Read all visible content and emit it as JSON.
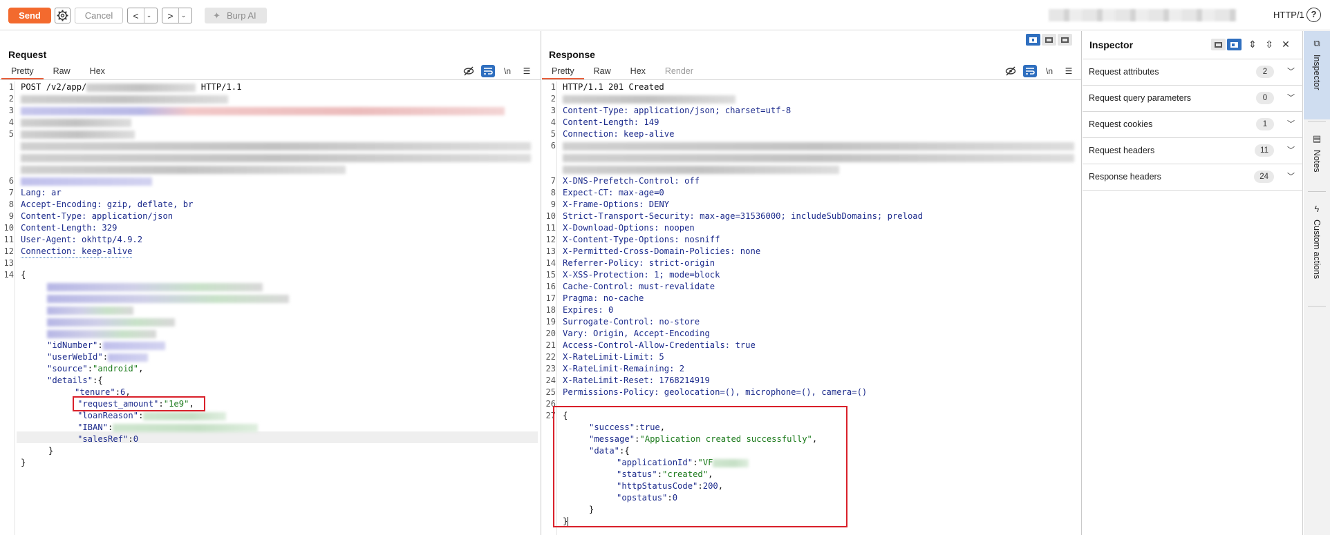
{
  "toolbar": {
    "send": "Send",
    "cancel": "Cancel",
    "back_glyph": "<",
    "forward_glyph": ">",
    "dropdown_glyph": "⌄",
    "burp_ai": "Burp AI",
    "protocol": "HTTP/1",
    "help": "?",
    "icons": [
      "gear-icon",
      "sparkle-icon",
      "help-icon"
    ]
  },
  "request": {
    "title": "Request",
    "tabs": [
      "Pretty",
      "Raw",
      "Hex"
    ],
    "active_tab": "Pretty",
    "lines": {
      "l1_method": "POST /v2/app/",
      "l1_proto": " HTTP/1.1",
      "l7": "Lang: ar",
      "l8": "Accept-Encoding: gzip, deflate, br",
      "l9": "Content-Type: application/json",
      "l10": "Content-Length: 329",
      "l11": "User-Agent: okhttp/4.9.2",
      "l12": "Connection: keep-alive",
      "l14": "{",
      "idNumber_key": "\"idNumber\"",
      "userWebId_key": "\"userWebId\"",
      "source_key": "\"source\"",
      "source_val": "\"android\"",
      "details_key": "\"details\"",
      "tenure_key": "\"tenure\"",
      "tenure_val": "6",
      "request_amount_key": "\"request_amount\"",
      "request_amount_val": "\"1e9\"",
      "loanReason_key": "\"loanReason\"",
      "iban_key": "\"IBAN\"",
      "salesRef_key": "\"salesRef\"",
      "salesRef_val": "0",
      "close_inner": "}",
      "close_outer": "}"
    }
  },
  "response": {
    "title": "Response",
    "tabs": [
      "Pretty",
      "Raw",
      "Hex",
      "Render"
    ],
    "active_tab": "Pretty",
    "lines": {
      "l1": "HTTP/1.1 201 Created",
      "l3": "Content-Type: application/json; charset=utf-8",
      "l4": "Content-Length: 149",
      "l5": "Connection: keep-alive",
      "l7": "X-DNS-Prefetch-Control: off",
      "l8": "Expect-CT: max-age=0",
      "l9": "X-Frame-Options: DENY",
      "l10": "Strict-Transport-Security: max-age=31536000; includeSubDomains; preload",
      "l11": "X-Download-Options: noopen",
      "l12": "X-Content-Type-Options: nosniff",
      "l13": "X-Permitted-Cross-Domain-Policies: none",
      "l14": "Referrer-Policy: strict-origin",
      "l15": "X-XSS-Protection: 1; mode=block",
      "l16": "Cache-Control: must-revalidate",
      "l17": "Pragma: no-cache",
      "l18": "Expires: 0",
      "l19": "Surrogate-Control: no-store",
      "l20": "Vary: Origin, Accept-Encoding",
      "l21": "Access-Control-Allow-Credentials: true",
      "l22": "X-RateLimit-Limit: 5",
      "l23": "X-RateLimit-Remaining: 2",
      "l24": "X-RateLimit-Reset: 1768214919",
      "l25": "Permissions-Policy: geolocation=(), microphone=(), camera=()",
      "l27": "{",
      "success_key": "\"success\"",
      "success_val": "true",
      "message_key": "\"message\"",
      "message_val": "\"Application created successfully\"",
      "data_key": "\"data\"",
      "applicationId_key": "\"applicationId\"",
      "applicationId_val": "\"VF",
      "status_key": "\"status\"",
      "status_val": "\"created\"",
      "httpStatusCode_key": "\"httpStatusCode\"",
      "httpStatusCode_val": "200",
      "opstatus_key": "\"opstatus\"",
      "opstatus_val": "0",
      "close_inner": "}",
      "close_outer": "}"
    }
  },
  "inspector": {
    "title": "Inspector",
    "rows": [
      {
        "label": "Request attributes",
        "count": "2"
      },
      {
        "label": "Request query parameters",
        "count": "0"
      },
      {
        "label": "Request cookies",
        "count": "1"
      },
      {
        "label": "Request headers",
        "count": "11"
      },
      {
        "label": "Response headers",
        "count": "24"
      }
    ]
  },
  "side_tabs": [
    "Inspector",
    "Notes",
    "Custom actions"
  ],
  "accent_color": "#f36a2e",
  "highlight_color": "#d9202a",
  "toggle_color": "#2f6fbf"
}
